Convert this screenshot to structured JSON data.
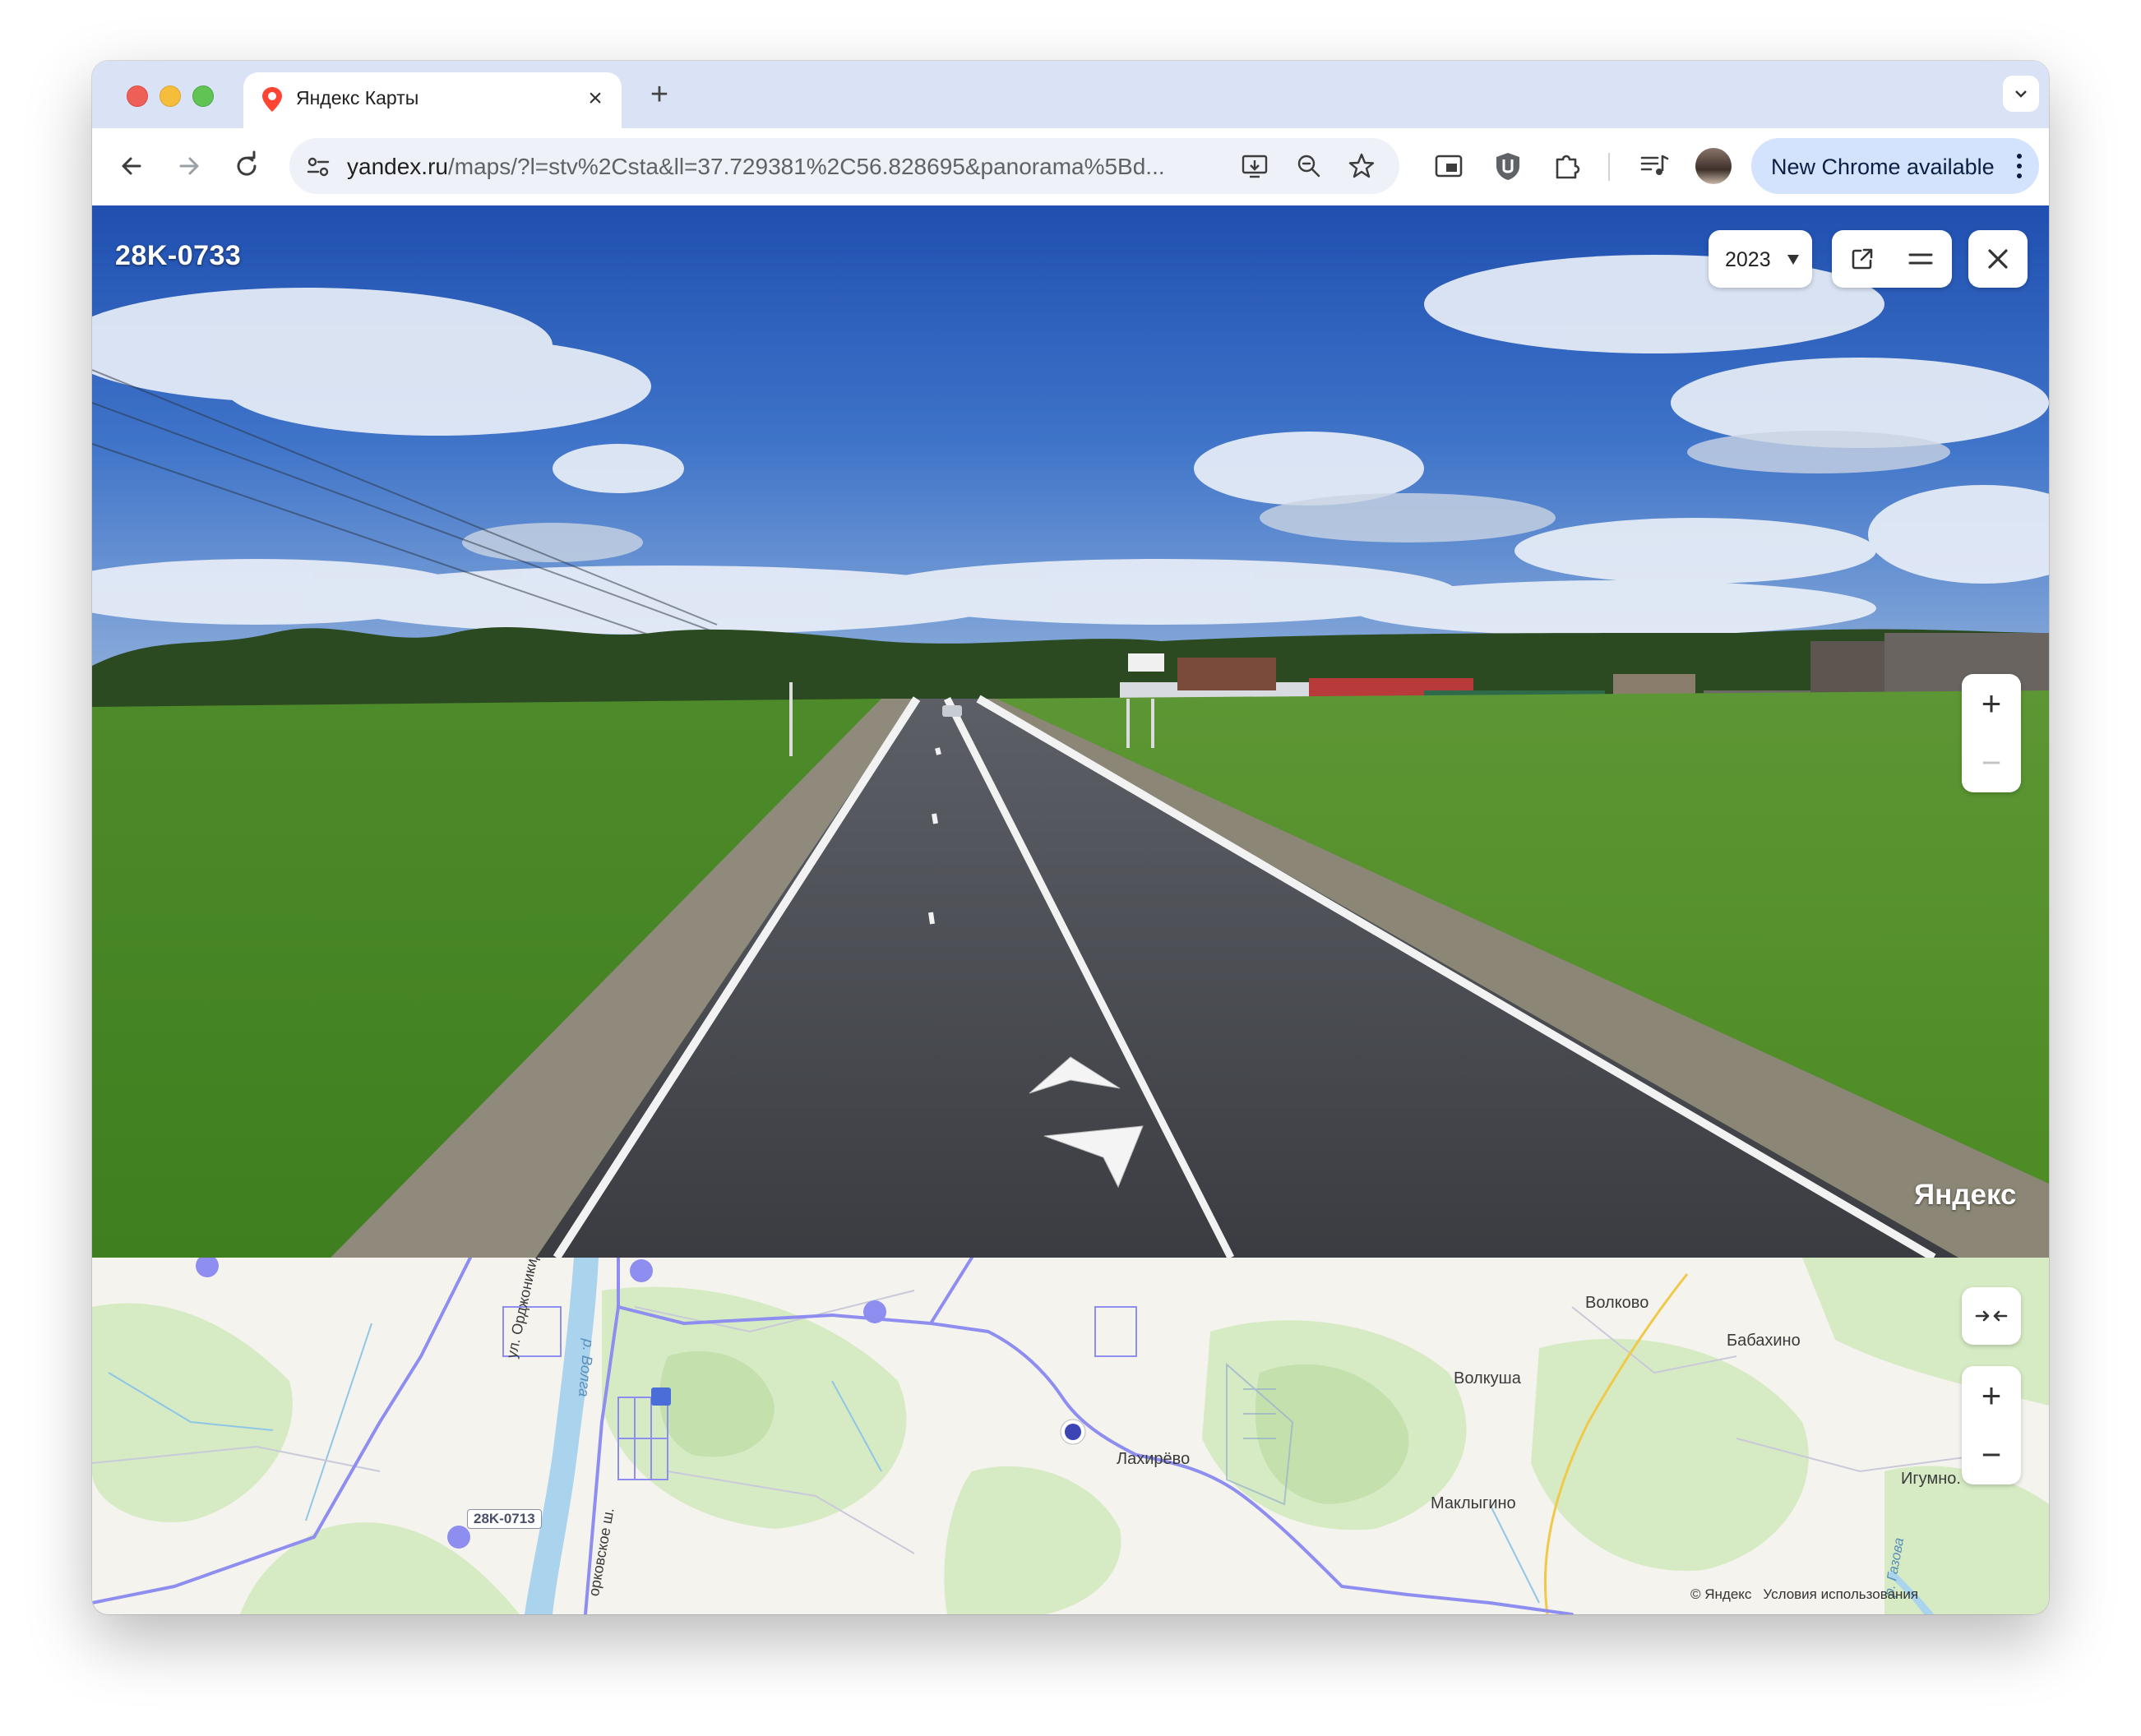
{
  "browser": {
    "tab_title": "Яндекс Карты",
    "url_host": "yandex.ru",
    "url_rest": "/maps/?l=stv%2Csta&ll=37.729381%2C56.828695&panorama%5Bd...",
    "update_label": "New Chrome available"
  },
  "panorama": {
    "road_label": "28K-0733",
    "year": "2023",
    "brand": "Яндекс",
    "zoom_in": "+",
    "zoom_out": "−"
  },
  "map": {
    "labels": {
      "volkovo": "Волково",
      "babakhino": "Бабахино",
      "volkusha": "Волкуша",
      "lakhirevo": "Лахирёво",
      "maklygino": "Маклыгино",
      "igumno": "Игумно.",
      "ordzhonikidze": "ул. Орджоникидзе",
      "volga": "р. Волга",
      "shosse": "орковское ш.",
      "gazovaya": "р. Газова"
    },
    "road_shield": "28K-0713",
    "zoom_in": "+",
    "zoom_out": "−",
    "copyright": "© Яндекс",
    "terms": "Условия использования"
  },
  "colors": {
    "accent": "#d3e3fd",
    "tab_strip": "#dae3f6",
    "map_route": "#8e8ef0"
  }
}
